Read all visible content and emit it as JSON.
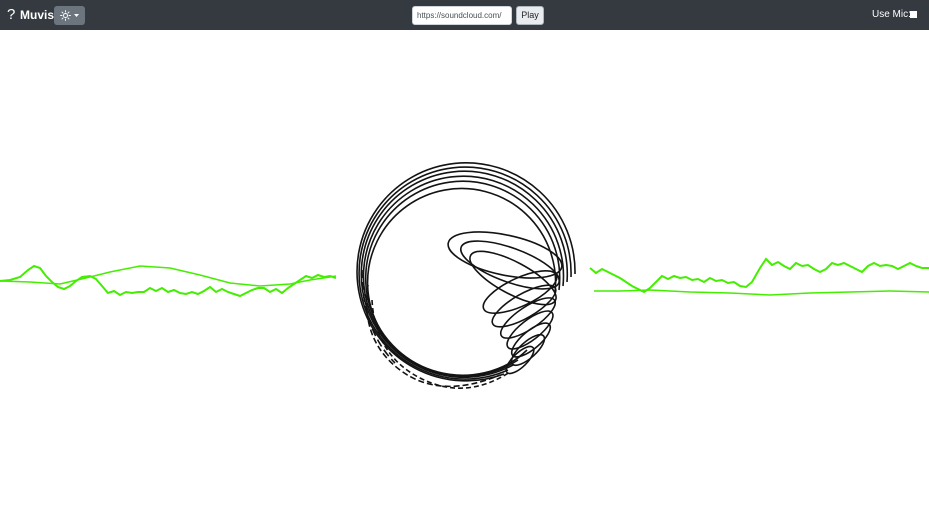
{
  "navbar": {
    "help_icon": "?",
    "brand": "Muvis",
    "theme_button_icon": "sun-icon",
    "url_input": {
      "value": "https://soundcloud.com/",
      "placeholder": ""
    },
    "play_label": "Play",
    "mic_label": "Use Mic:",
    "mic_enabled": false
  },
  "visualizer": {
    "wave_color": "#44ee00",
    "ring_color": "#000000",
    "background": "#ffffff"
  }
}
